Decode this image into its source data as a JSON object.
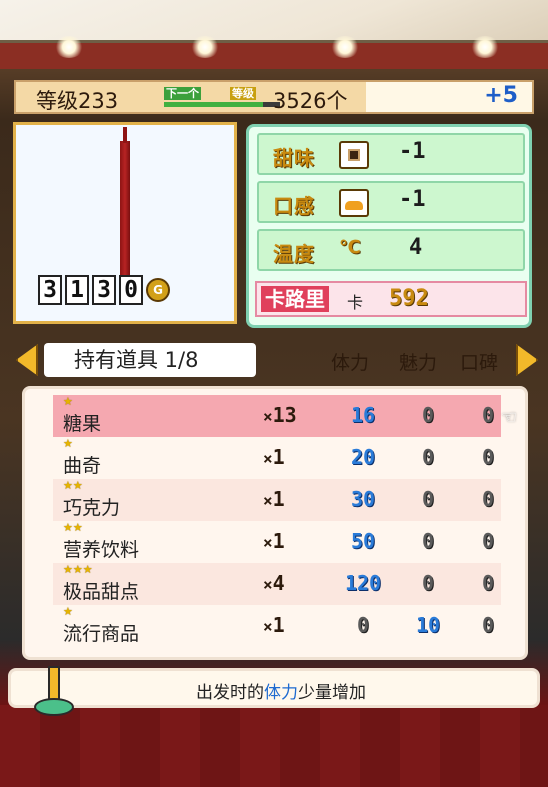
{
  "header": {
    "level_text": "等级233",
    "next_tag": "下一个",
    "grade_tag": "等级",
    "count_text": "3526个",
    "plus_text": "+5",
    "progress": 0.85
  },
  "item_preview": {
    "price_digits": [
      "3",
      "1",
      "3",
      "0"
    ],
    "currency_icon": "G"
  },
  "stats": [
    {
      "label": "甜味",
      "icon": "sweet-icon",
      "value": "-1"
    },
    {
      "label": "口感",
      "icon": "bread-icon",
      "value": "-1"
    },
    {
      "label": "温度",
      "icon": "celsius-icon",
      "value": "4"
    }
  ],
  "calorie": {
    "label": "卡路里",
    "unit": "卡",
    "value": "592"
  },
  "tabbar": {
    "title": "持有道具 1/8",
    "col_stamina": "体力",
    "col_charm": "魅力",
    "col_reputation": "口碑"
  },
  "items": [
    {
      "stars": "★",
      "name": "糖果",
      "qty": "13",
      "stamina": "16",
      "charm": "0",
      "reputation": "0"
    },
    {
      "stars": "★",
      "name": "曲奇",
      "qty": "1",
      "stamina": "20",
      "charm": "0",
      "reputation": "0"
    },
    {
      "stars": "★★",
      "name": "巧克力",
      "qty": "1",
      "stamina": "30",
      "charm": "0",
      "reputation": "0"
    },
    {
      "stars": "★★",
      "name": "营养饮料",
      "qty": "1",
      "stamina": "50",
      "charm": "0",
      "reputation": "0"
    },
    {
      "stars": "★★★",
      "name": "极品甜点",
      "qty": "4",
      "stamina": "120",
      "charm": "0",
      "reputation": "0"
    },
    {
      "stars": "★",
      "name": "流行商品",
      "qty": "1",
      "stamina": "0",
      "charm": "10",
      "reputation": "0"
    }
  ],
  "qty_prefix": "×",
  "footer": {
    "pre": "出发时的",
    "highlight": "体力",
    "post": "少量增加"
  },
  "colors": {
    "highlight_row": "#f5a8b0",
    "blue_value": "#2a7bd8",
    "accent_gold": "#f2b92a"
  }
}
